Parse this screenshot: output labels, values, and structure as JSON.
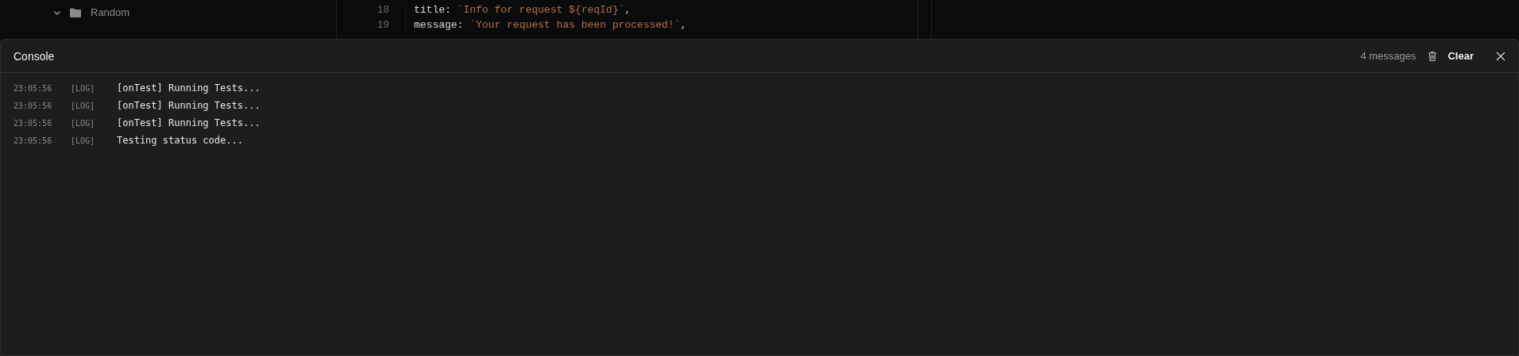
{
  "sidebar": {
    "folder": {
      "label": "Random",
      "expanded": true
    }
  },
  "editor": {
    "lines": [
      {
        "number": "18",
        "key": "title: ",
        "string": "`Info for request ${reqId}`",
        "punct": ","
      },
      {
        "number": "19",
        "key": "message: ",
        "string": "`Your request has been processed!`",
        "punct": ","
      }
    ]
  },
  "console": {
    "title": "Console",
    "count": "4 messages",
    "clear": "Clear",
    "logs": [
      {
        "time": "23:05:56",
        "level": "[LOG]",
        "message": "[onTest] Running Tests..."
      },
      {
        "time": "23:05:56",
        "level": "[LOG]",
        "message": "[onTest] Running Tests..."
      },
      {
        "time": "23:05:56",
        "level": "[LOG]",
        "message": "[onTest] Running Tests..."
      },
      {
        "time": "23:05:56",
        "level": "[LOG]",
        "message": "Testing status code..."
      }
    ]
  }
}
